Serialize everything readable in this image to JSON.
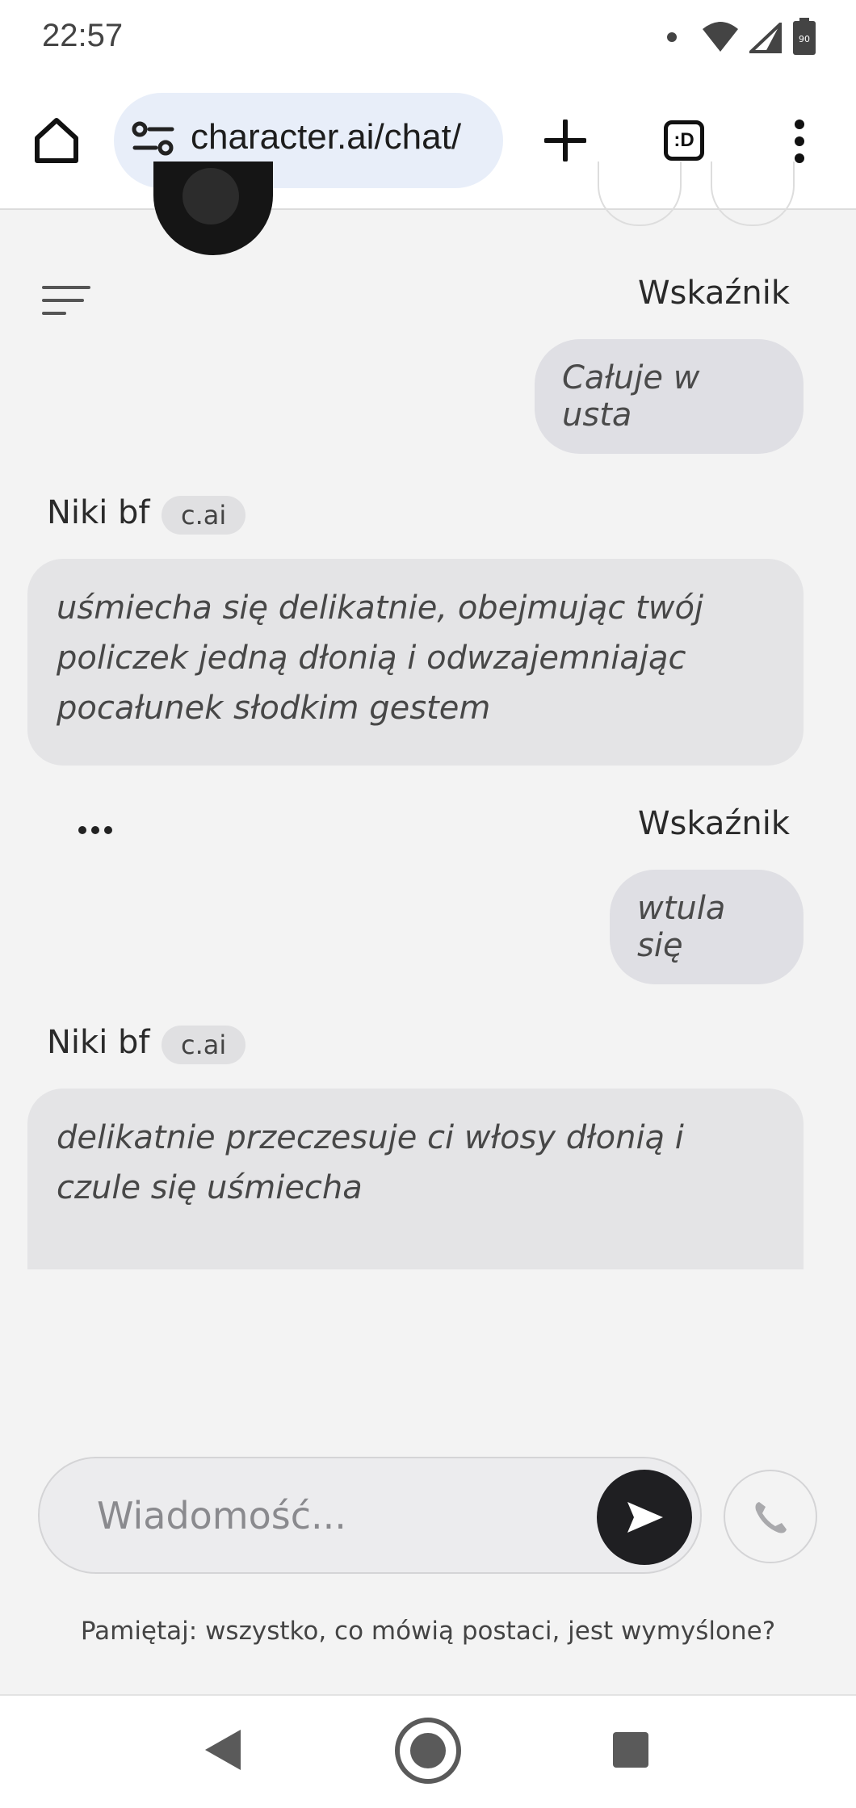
{
  "status_bar": {
    "time": "22:57",
    "battery_level": "90"
  },
  "browser": {
    "url": "character.ai/chat/",
    "tab_count": ":D"
  },
  "chat": {
    "messages": [
      {
        "sender": "Wskaźnik",
        "role": "user",
        "text": "Całuje w usta"
      },
      {
        "sender": "Niki bf",
        "badge": "c.ai",
        "role": "bot",
        "text": "uśmiecha się delikatnie, obejmując twój policzek jedną dłonią i odwzajemniając pocałunek słodkim gestem"
      },
      {
        "sender": "Wskaźnik",
        "role": "user",
        "text": "wtula się"
      },
      {
        "sender": "Niki bf",
        "badge": "c.ai",
        "role": "bot",
        "text": "delikatnie przeczesuje ci włosy dłonią i czule się uśmiecha"
      }
    ]
  },
  "composer": {
    "placeholder": "Wiadomość..."
  },
  "disclaimer": "Pamiętaj: wszystko, co mówią postaci, jest wymyślone?",
  "colors": {
    "bubble_user": "#dfdfe4",
    "bubble_bot": "#e4e4e6",
    "send_button": "#1f1f22",
    "url_bar": "#e8eef9"
  }
}
